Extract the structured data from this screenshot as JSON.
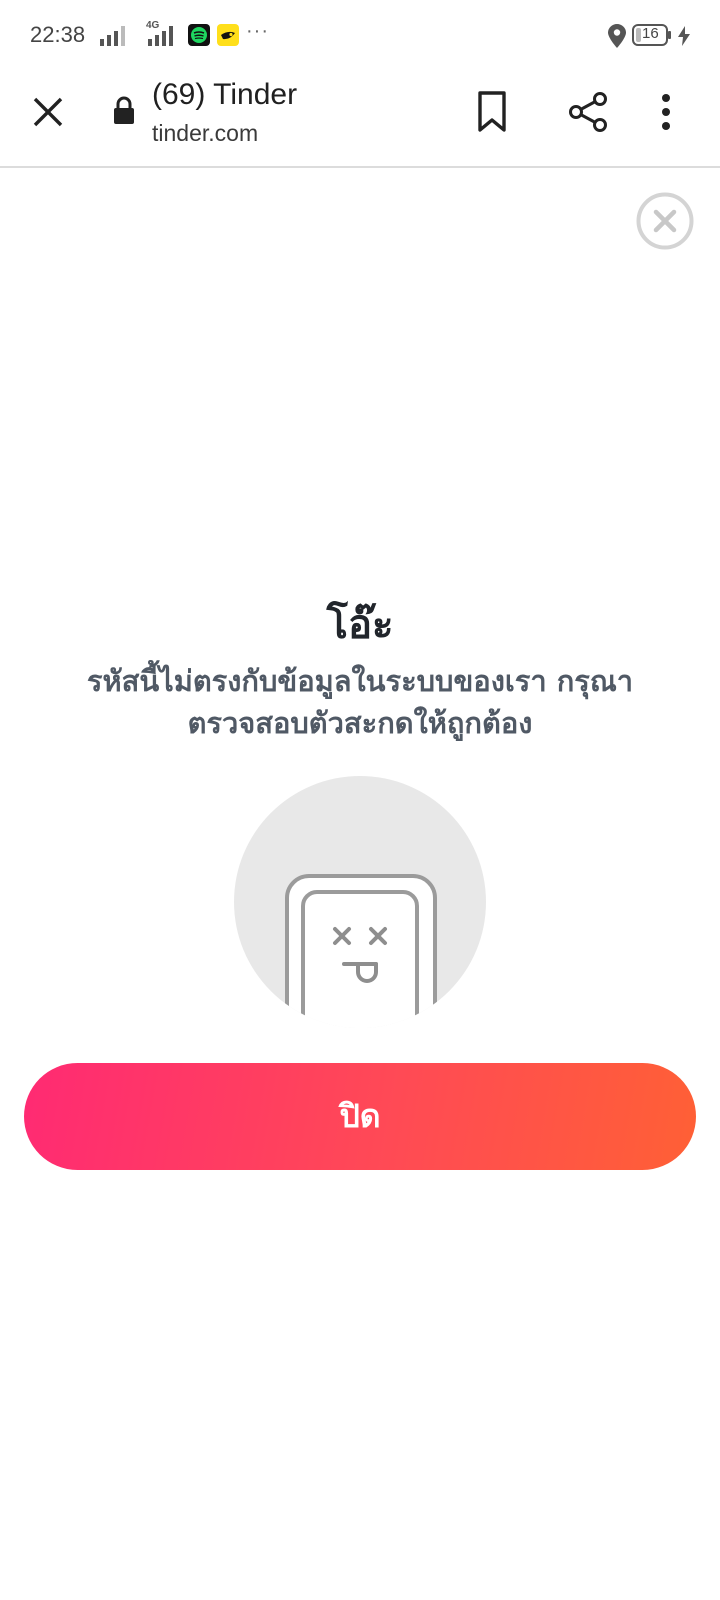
{
  "status_bar": {
    "time": "22:38",
    "network_label": "4G",
    "battery_level": "16",
    "icons": [
      "signal-icon",
      "signal-4g-icon",
      "spotify-icon",
      "app-notification-icon",
      "more-notifications-icon",
      "location-icon",
      "battery-icon",
      "charging-icon"
    ]
  },
  "browser": {
    "title": "(69) Tinder",
    "url": "tinder.com",
    "icons": [
      "close-icon",
      "lock-icon",
      "bookmark-icon",
      "share-icon",
      "more-vert-icon"
    ]
  },
  "dialog": {
    "title": "โอ๊ะ",
    "message_line1": "รหัสนี้ไม่ตรงกับข้อมูลในระบบของเรา กรุณา",
    "message_line2": "ตรวจสอบตัวสะกดให้ถูกต้อง",
    "button_label": "ปิด",
    "icons": [
      "dialog-close-icon",
      "sad-phone-icon"
    ]
  },
  "colors": {
    "button_gradient_start": "#ff2a73",
    "button_gradient_end": "#ff6035",
    "title_text": "#21252b",
    "body_text": "#505965",
    "illustration_bg": "#e8e8e8"
  }
}
